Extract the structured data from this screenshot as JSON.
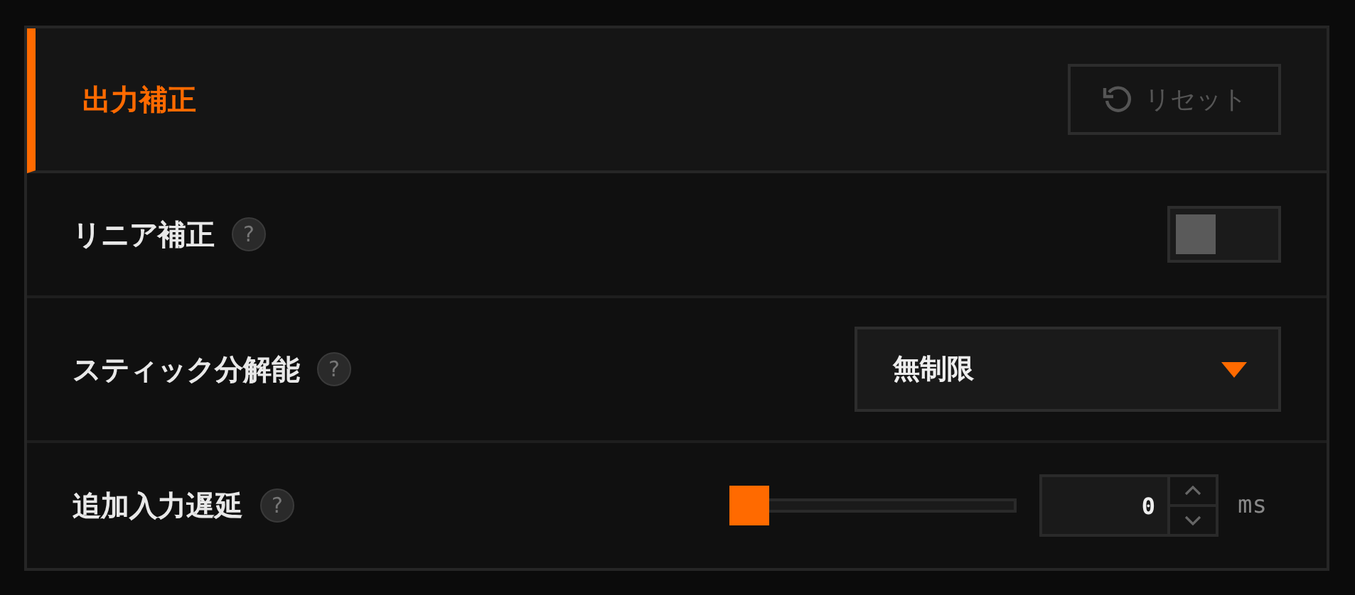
{
  "section": {
    "title": "出力補正",
    "reset": {
      "label": "リセット",
      "disabled": true
    }
  },
  "settings": [
    {
      "kind": "toggle",
      "label": "リニア補正",
      "help": "?",
      "on": false
    },
    {
      "kind": "select",
      "label": "スティック分解能",
      "help": "?",
      "value": "無制限"
    },
    {
      "kind": "slider",
      "label": "追加入力遅延",
      "help": "?",
      "level": 0,
      "value": "0",
      "unit": "ms"
    }
  ]
}
